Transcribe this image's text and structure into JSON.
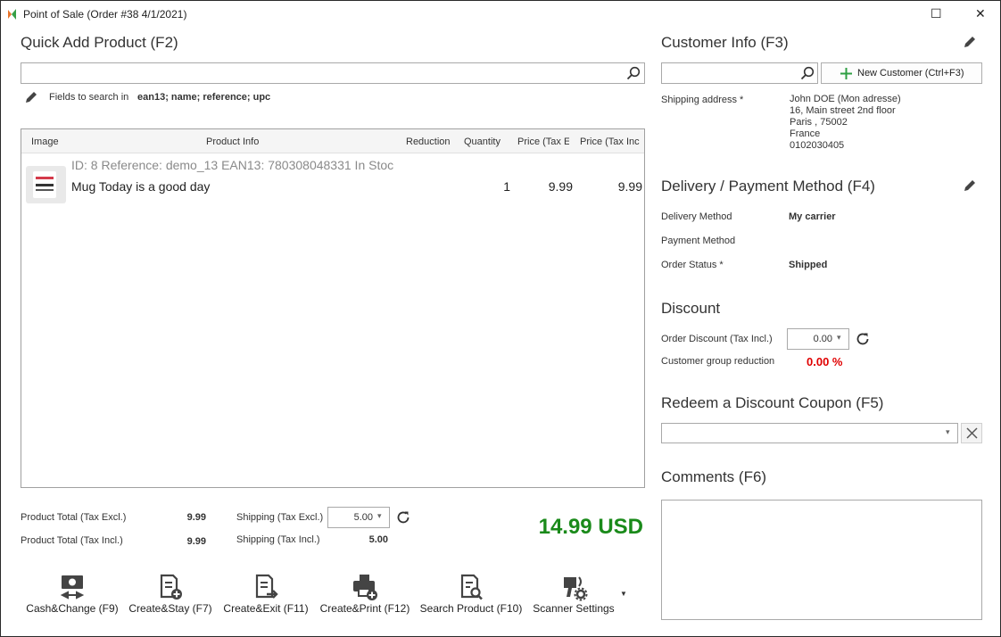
{
  "window": {
    "title": "Point of Sale (Order #38 4/1/2021)",
    "maximize_glyph": "☐",
    "close_glyph": "✕"
  },
  "quick_add": {
    "title": "Quick Add Product (F2)",
    "search_value": "",
    "fields_label": "Fields to search in",
    "fields_value": "ean13; name; reference; upc"
  },
  "grid": {
    "columns": [
      "Image",
      "Product Info",
      "Reduction",
      "Quantity",
      "Price (Tax E",
      "Price (Tax Inc"
    ],
    "rows": [
      {
        "meta": "ID: 8 Reference: demo_13 EAN13: 780308048331 In Stoc",
        "name": "Mug Today is a good day",
        "reduction": "",
        "quantity": "1",
        "price_excl": "9.99",
        "price_incl": "9.99"
      }
    ]
  },
  "totals": {
    "product_total_excl_label": "Product Total (Tax Excl.)",
    "product_total_excl_value": "9.99",
    "product_total_incl_label": "Product Total (Tax Incl.)",
    "product_total_incl_value": "9.99",
    "shipping_excl_label": "Shipping (Tax Excl.)",
    "shipping_excl_value": "5.00",
    "shipping_incl_label": "Shipping (Tax Incl.)",
    "shipping_incl_value": "5.00",
    "grand_total": "14.99 USD"
  },
  "toolbar": {
    "cash_change": "Cash&Change (F9)",
    "create_stay": "Create&Stay (F7)",
    "create_exit": "Create&Exit (F11)",
    "create_print": "Create&Print (F12)",
    "search_product": "Search Product (F10)",
    "scanner_settings": "Scanner Settings"
  },
  "customer": {
    "title": "Customer Info (F3)",
    "search_value": "",
    "new_customer_label": "New Customer (Ctrl+F3)",
    "shipping_label": "Shipping address *",
    "address_lines": [
      "John DOE (Mon adresse)",
      "16, Main street 2nd floor",
      "Paris ,  75002",
      "France",
      "0102030405"
    ]
  },
  "delivery": {
    "title": "Delivery / Payment Method (F4)",
    "delivery_method_label": "Delivery Method",
    "delivery_method_value": "My carrier",
    "payment_method_label": "Payment Method",
    "payment_method_value": "",
    "order_status_label": "Order Status *",
    "order_status_value": "Shipped"
  },
  "discount": {
    "title": "Discount",
    "order_discount_label": "Order Discount (Tax Incl.)",
    "order_discount_value": "0.00",
    "group_reduction_label": "Customer group reduction",
    "group_reduction_value": "0.00 %"
  },
  "coupon": {
    "title": "Redeem a Discount Coupon (F5)",
    "value": ""
  },
  "comments": {
    "title": "Comments (F6)",
    "value": ""
  },
  "colors": {
    "total_green": "#1a8a1a",
    "reduction_red": "#e00000",
    "accent_green": "#2ea043"
  }
}
